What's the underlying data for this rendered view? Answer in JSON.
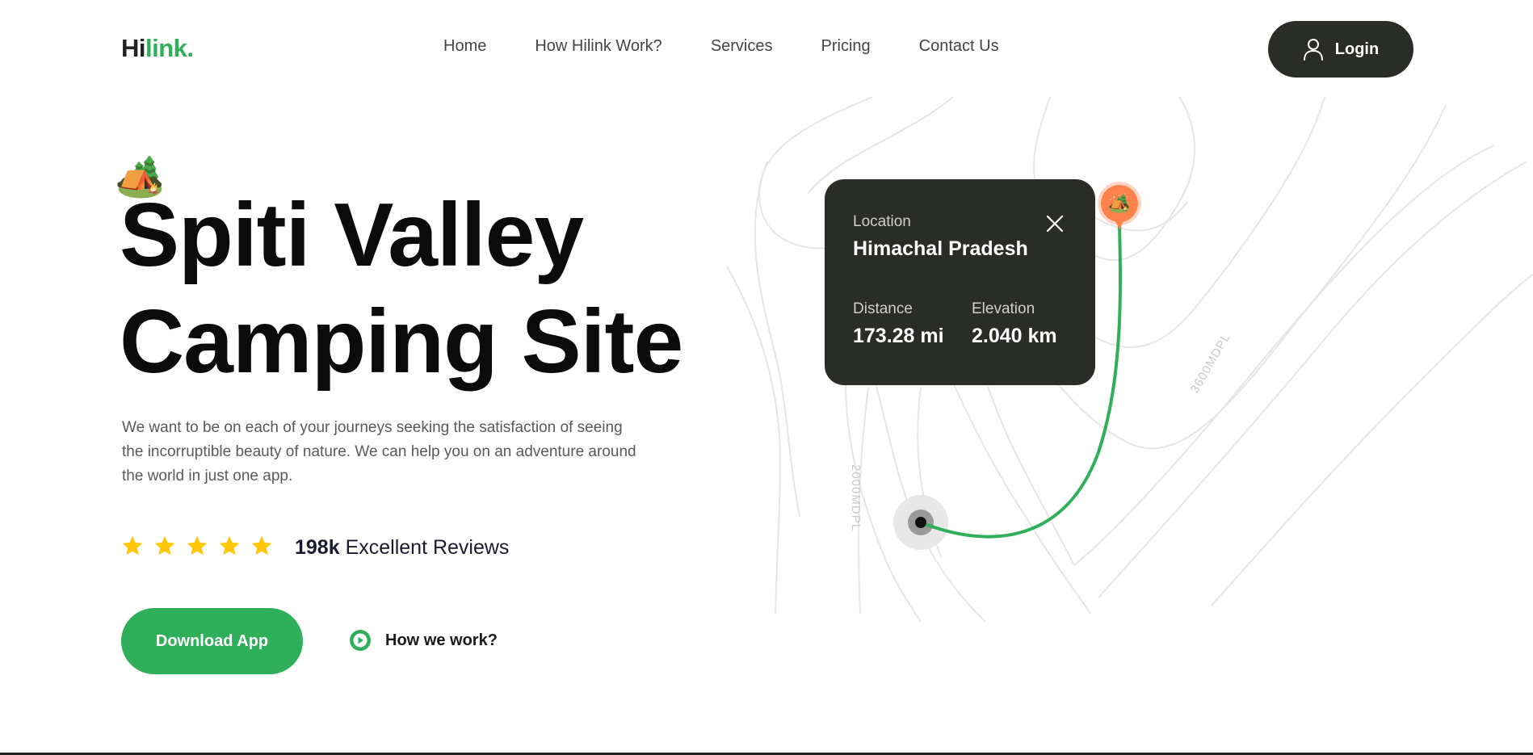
{
  "header": {
    "logo_part1": "Hi",
    "logo_part2": "link.",
    "nav": [
      "Home",
      "How Hilink Work?",
      "Services",
      "Pricing",
      "Contact Us"
    ],
    "login_label": "Login"
  },
  "hero": {
    "camp_emoji": "🏕️",
    "title_line1": "Spiti Valley",
    "title_line2": "Camping Site",
    "description": "We want to be on each of your journeys seeking the satisfaction of seeing the incorruptible beauty of nature. We can help you on an adventure around the world in just one app.",
    "rating_stars": 5,
    "reviews_count": "198k",
    "reviews_label": "Excellent Reviews",
    "download_label": "Download App",
    "how_label": "How we work?"
  },
  "map": {
    "contour_label_1": "2000MDPL",
    "contour_label_2": "3600MDPL",
    "pin_emoji": "🏕️"
  },
  "card": {
    "location_label": "Location",
    "location_value": "Himachal Pradesh",
    "distance_label": "Distance",
    "distance_value": "173.28 mi",
    "elevation_label": "Elevation",
    "elevation_value": "2.040 km"
  },
  "colors": {
    "brand_green": "#30af5b",
    "dark": "#292c27",
    "star": "#fec601",
    "pin_orange": "#ff814c"
  },
  "icons": [
    "user-icon",
    "close-icon",
    "star-icon",
    "play-icon",
    "camp-icon"
  ]
}
